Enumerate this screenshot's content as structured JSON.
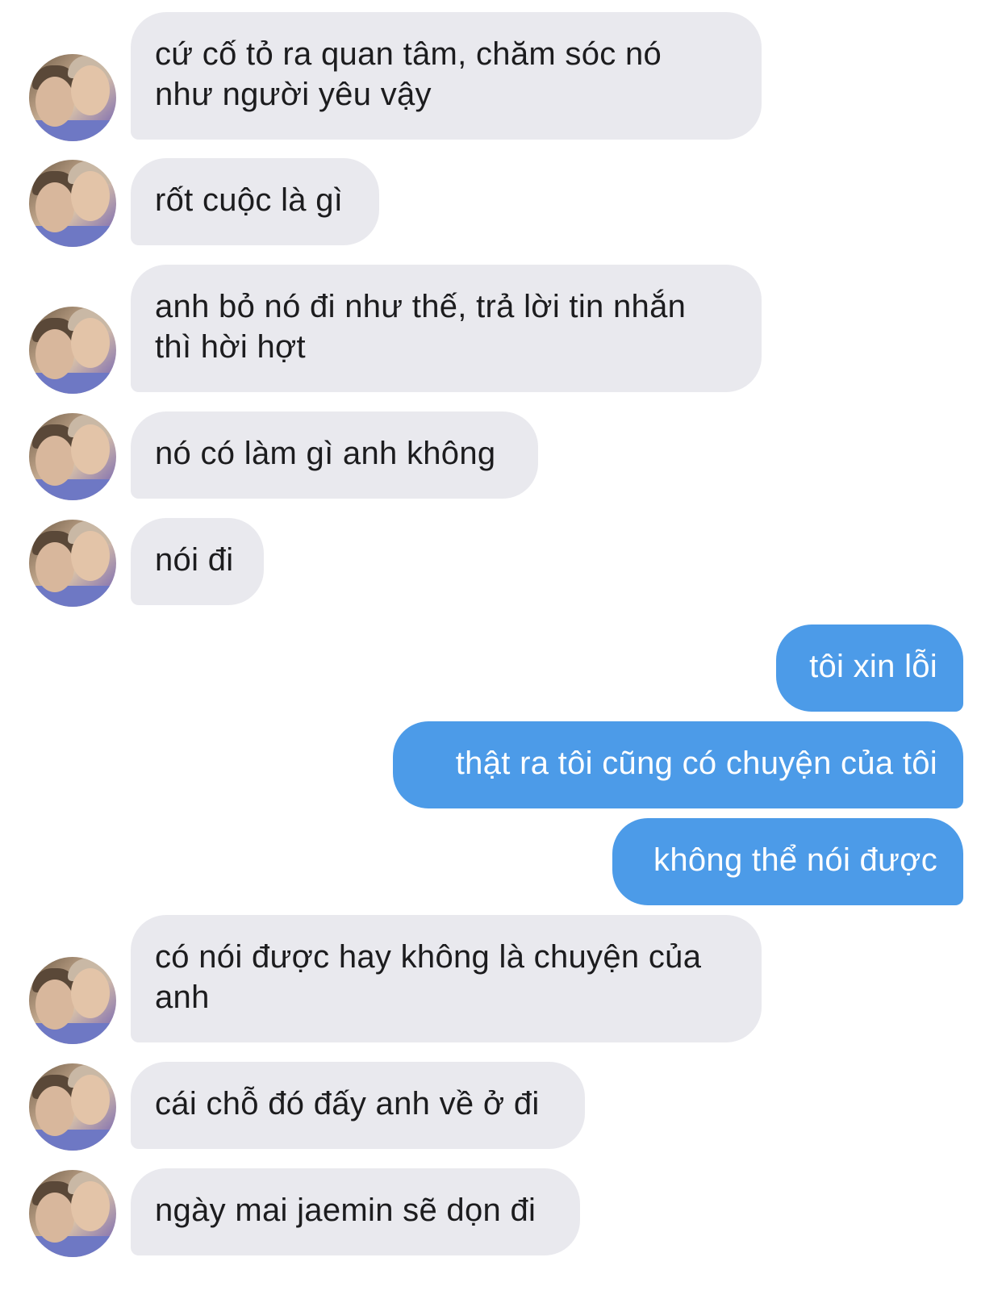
{
  "conversation": {
    "messages": [
      {
        "side": "in",
        "text": "cứ cố tỏ ra quan tâm, chăm sóc nó\nnhư người yêu vậy"
      },
      {
        "side": "in",
        "text": "rốt cuộc là gì"
      },
      {
        "side": "in",
        "text": "anh bỏ nó đi như thế, trả lời tin nhắn\nthì hời hợt"
      },
      {
        "side": "in",
        "text": "nó có làm gì anh không"
      },
      {
        "side": "in",
        "text": "nói đi"
      },
      {
        "side": "out",
        "text": "tôi xin lỗi"
      },
      {
        "side": "out",
        "text": "thật ra tôi cũng có chuyện của tôi"
      },
      {
        "side": "out",
        "text": "không thể nói được"
      },
      {
        "side": "in",
        "text": "có nói được hay không là chuyện của\nanh"
      },
      {
        "side": "in",
        "text": "cái chỗ đó đấy anh về ở đi"
      },
      {
        "side": "in",
        "text": "ngày mai jaemin sẽ dọn đi"
      }
    ]
  },
  "colors": {
    "incoming_bubble": "#e9e9ee",
    "outgoing_bubble": "#4c9be8",
    "incoming_text": "#1c1c1e",
    "outgoing_text": "#ffffff"
  }
}
